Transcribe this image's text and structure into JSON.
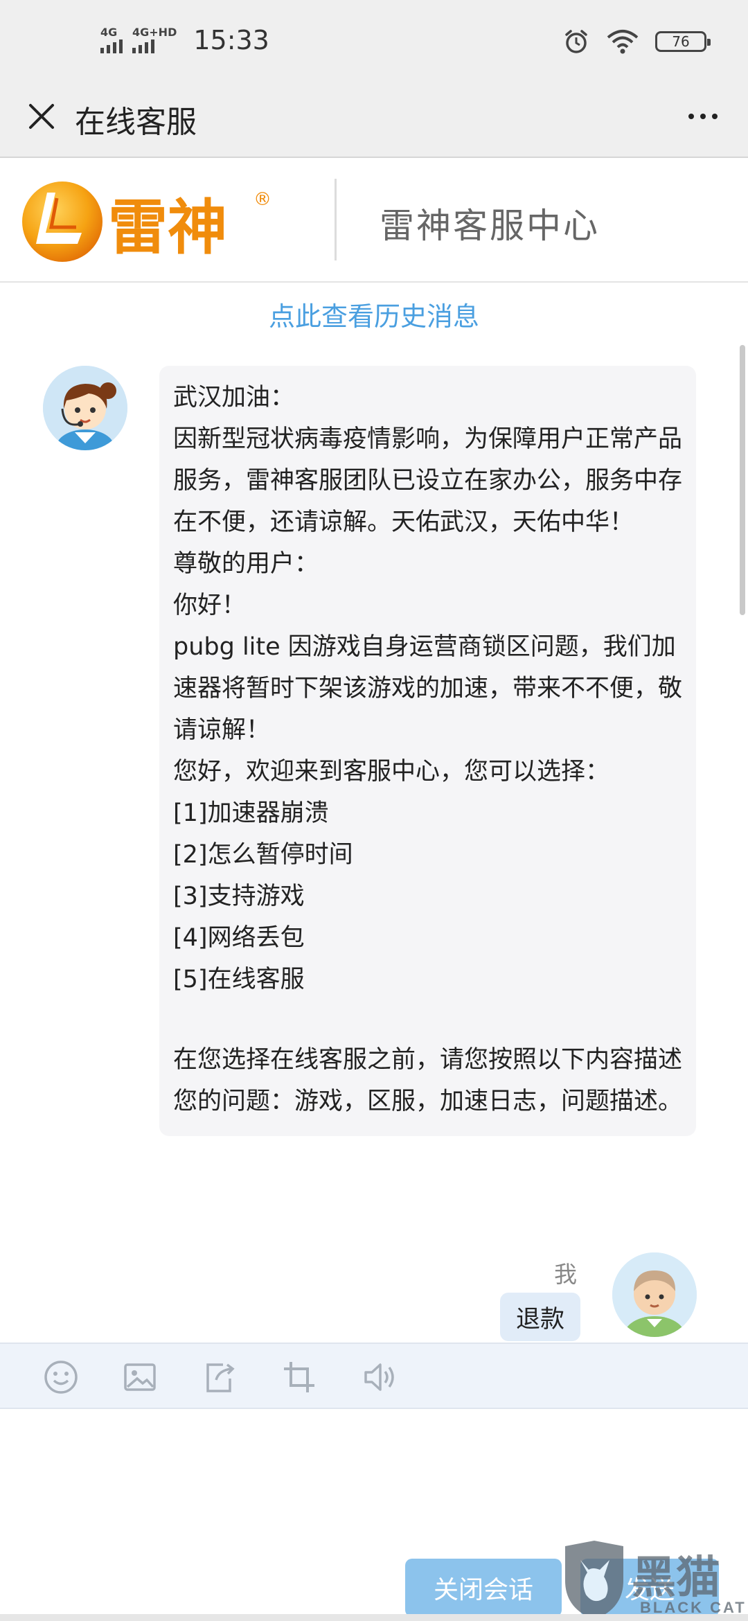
{
  "status_bar": {
    "network1": "4G",
    "network2": "4G+HD",
    "time": "15:33",
    "battery": "76"
  },
  "titlebar": {
    "title": "在线客服"
  },
  "brand": {
    "logo_text": "雷神",
    "registered": "®",
    "center_name": "雷神客服中心"
  },
  "chat": {
    "history_link": "点此查看历史消息",
    "agent_message_lines": [
      "武汉加油：",
      "因新型冠状病毒疫情影响，为保障用户正常产品服务，雷神客服团队已设立在家办公，服务中存在不便，还请谅解。天佑武汉，天佑中华！",
      "尊敬的用户：",
      "你好！",
      "pubg lite 因游戏自身运营商锁区问题，我们加速器将暂时下架该游戏的加速，带来不不便，敬请谅解！",
      "您好，欢迎来到客服中心，您可以选择：",
      "[1]加速器崩溃",
      "[2]怎么暂停时间",
      "[3]支持游戏",
      "[4]网络丢包",
      "[5]在线客服"
    ],
    "agent_message_tail": "在您选择在线客服之前，请您按照以下内容描述您的问题：游戏，区服，加速日志，问题描述。",
    "me_label": "我",
    "me_message": "退款"
  },
  "toolbar": {
    "icons": [
      "emoji-icon",
      "image-icon",
      "file-upload-icon",
      "crop-icon",
      "voice-icon"
    ]
  },
  "input": {
    "close_session_label": "关闭会话",
    "send_label": "发送"
  },
  "watermark": {
    "big": "黑猫",
    "small": "BLACK CAT"
  }
}
